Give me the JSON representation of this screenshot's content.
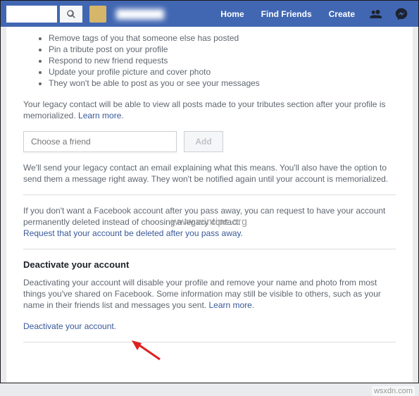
{
  "topbar": {
    "search_placeholder": "",
    "user_name": "████████",
    "home": "Home",
    "find_friends": "Find Friends",
    "create": "Create"
  },
  "bullets": [
    "Remove tags of you that someone else has posted",
    "Pin a tribute post on your profile",
    "Respond to new friend requests",
    "Update your profile picture and cover photo",
    "They won't be able to post as you or see your messages"
  ],
  "legacy": {
    "para1": "Your legacy contact will be able to view all posts made to your tributes section after your profile is memorialized. ",
    "learn_more": "Learn more",
    "friend_placeholder": "Choose a friend",
    "add": "Add",
    "para2": "We'll send your legacy contact an email explaining what this means. You'll also have the option to send them a message right away. They won't be notified again until your account is memorialized.",
    "para3": "If you don't want a Facebook account after you pass away, you can request to have your account permanently deleted instead of choosing a legacy contact.",
    "request_link": "Request that your account be deleted after you pass away."
  },
  "deactivate": {
    "title": "Deactivate your account",
    "para": "Deactivating your account will disable your profile and remove your name and photo from most things you've shared on Facebook. Some information may still be visible to others, such as your name in their friends list and messages you sent. ",
    "learn_more": "Learn more",
    "link": "Deactivate your account",
    "dot": "."
  },
  "watermark": "www.wintips.org",
  "credit": "wsxdn.com"
}
